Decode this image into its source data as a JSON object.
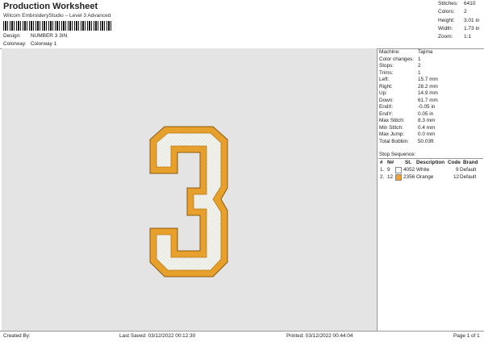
{
  "header": {
    "title": "Production Worksheet",
    "subtitle": "Wilcom EmbroideryStudio – Level 3 Advanced",
    "design_label": "Design:",
    "design_value": "NUMBER 3 3IN",
    "colorway_label": "Colorway:",
    "colorway_value": "Colorway 1"
  },
  "stats": [
    {
      "k": "Stitches:",
      "v": "6410"
    },
    {
      "k": "Colors:",
      "v": "2"
    },
    {
      "k": "Height:",
      "v": "3.01 in"
    },
    {
      "k": "Width:",
      "v": "1.73 in"
    },
    {
      "k": "Zoom:",
      "v": "1:1"
    }
  ],
  "details": [
    {
      "k": "Machine:",
      "v": "Tajima"
    },
    {
      "k": "Color changes:",
      "v": "1"
    },
    {
      "k": "Stops:",
      "v": "2"
    },
    {
      "k": "Trims:",
      "v": "1"
    },
    {
      "k": "Left:",
      "v": "15.7 mm"
    },
    {
      "k": "Right:",
      "v": "28.2 mm"
    },
    {
      "k": "Up:",
      "v": "14.9 mm"
    },
    {
      "k": "Down:",
      "v": "61.7 mm"
    },
    {
      "k": "EndX:",
      "v": "-0.05 in"
    },
    {
      "k": "EndY:",
      "v": "0.05 in"
    },
    {
      "k": "Max Stitch:",
      "v": "8.3 mm"
    },
    {
      "k": "Min Stitch:",
      "v": "0.4 mm"
    },
    {
      "k": "Max Jump:",
      "v": "0.0 mm"
    },
    {
      "k": "Total Bobbin:",
      "v": "50.03ft"
    }
  ],
  "sequence": {
    "title": "Stop Sequence:",
    "headers": {
      "index": "#",
      "n": "N#",
      "st": "St.",
      "description": "Description",
      "code": "Code",
      "brand": "Brand"
    },
    "rows": [
      {
        "index": "1.",
        "n": "9",
        "st": "4052",
        "description": "White",
        "code": "9",
        "brand": "Default",
        "color": "#ffffff"
      },
      {
        "index": "2.",
        "n": "12",
        "st": "2356",
        "description": "Orange",
        "code": "12",
        "brand": "Default",
        "color": "#f0a030"
      }
    ]
  },
  "design_colors": {
    "fill": "#f5f5ef",
    "outline": "#e8a02c",
    "edge": "#8a5a10"
  },
  "footer": {
    "created_by": "Created By:",
    "last_saved": "Last Saved: 03/12/2022 00:12:30",
    "printed": "Printed: 03/12/2022 00:44:04",
    "page": "Page 1 of 1"
  }
}
